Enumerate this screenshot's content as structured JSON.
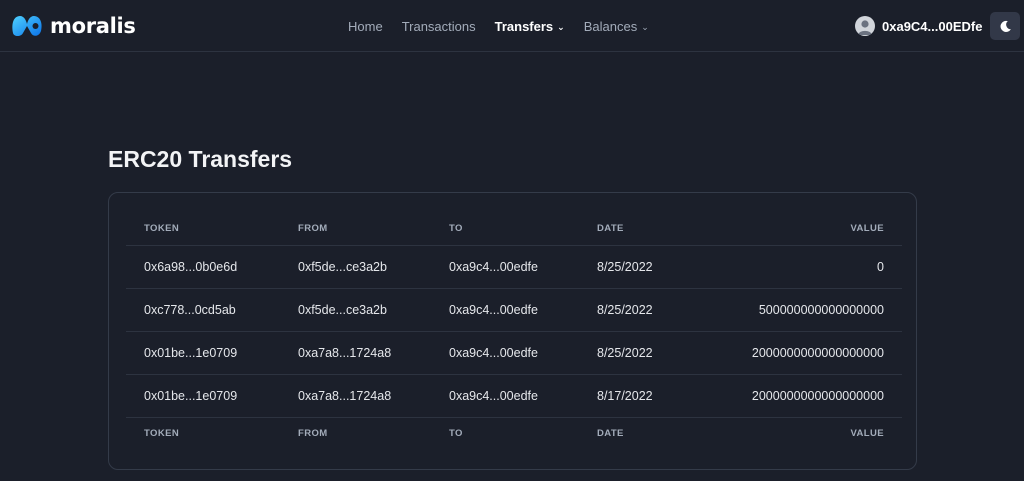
{
  "app": {
    "brand": "moralis"
  },
  "nav": {
    "items": [
      {
        "label": "Home",
        "active": false,
        "dropdown": false
      },
      {
        "label": "Transactions",
        "active": false,
        "dropdown": false
      },
      {
        "label": "Transfers",
        "active": true,
        "dropdown": true
      },
      {
        "label": "Balances",
        "active": false,
        "dropdown": true
      }
    ]
  },
  "account": {
    "address": "0xa9C4...00EDfe"
  },
  "theme_toggle_icon": "moon-icon",
  "page": {
    "title": "ERC20 Transfers"
  },
  "table": {
    "columns": [
      "TOKEN",
      "FROM",
      "TO",
      "DATE",
      "VALUE"
    ],
    "rows": [
      [
        "0x6a98...0b0e6d",
        "0xf5de...ce3a2b",
        "0xa9c4...00edfe",
        "8/25/2022",
        "0"
      ],
      [
        "0xc778...0cd5ab",
        "0xf5de...ce3a2b",
        "0xa9c4...00edfe",
        "8/25/2022",
        "500000000000000000"
      ],
      [
        "0x01be...1e0709",
        "0xa7a8...1724a8",
        "0xa9c4...00edfe",
        "8/25/2022",
        "2000000000000000000"
      ],
      [
        "0x01be...1e0709",
        "0xa7a8...1724a8",
        "0xa9c4...00edfe",
        "8/17/2022",
        "2000000000000000000"
      ]
    ]
  },
  "colors": {
    "background": "#1b1f2a",
    "border": "#343b49",
    "logo_gradient": [
      "#4fd1ff",
      "#0b72e7"
    ]
  }
}
